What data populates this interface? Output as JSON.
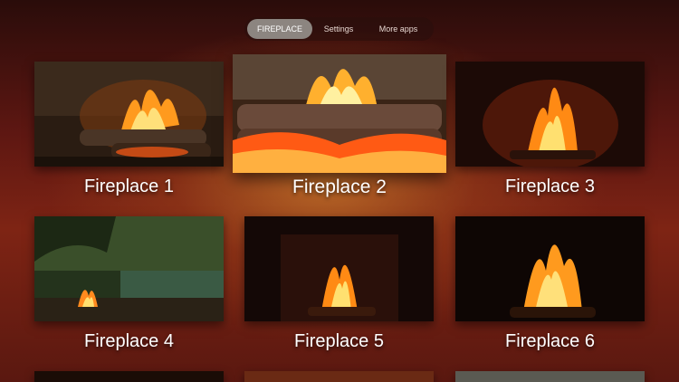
{
  "nav": {
    "tabs": [
      {
        "label": "FIREPLACE"
      },
      {
        "label": "Settings"
      },
      {
        "label": "More apps"
      }
    ]
  },
  "grid": {
    "items": [
      {
        "label": "Fireplace 1"
      },
      {
        "label": "Fireplace 2"
      },
      {
        "label": "Fireplace 3"
      },
      {
        "label": "Fireplace 4"
      },
      {
        "label": "Fireplace 5"
      },
      {
        "label": "Fireplace 6"
      }
    ]
  }
}
